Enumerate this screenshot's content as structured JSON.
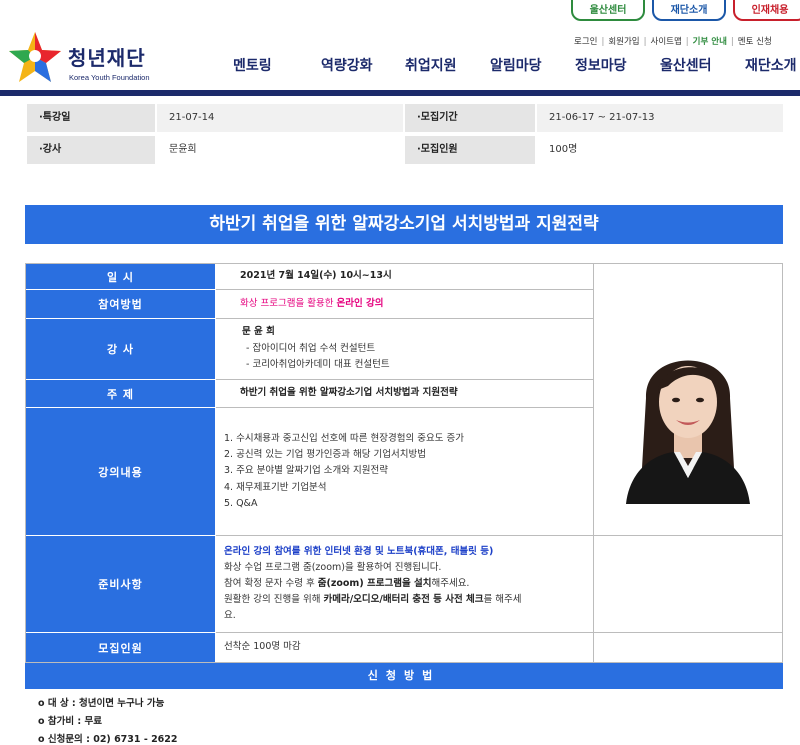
{
  "header": {
    "top_buttons": {
      "ulsan": "울산센터",
      "about": "재단소개",
      "hire": "인재채용"
    },
    "util_links": [
      "로그인",
      "회원가입",
      "사이트맵",
      "기부 안내",
      "멘토 신청"
    ],
    "logo": {
      "kr": "청년재단",
      "en": "Korea Youth Foundation"
    },
    "nav": [
      "멘토링",
      "역량강화",
      "취업지원",
      "알림마당",
      "정보마당",
      "울산센터",
      "재단소개"
    ]
  },
  "info": {
    "special_date_label": "·특강일",
    "special_date": "21-07-14",
    "period_label": "·모집기간",
    "period": "21-06-17 ~ 21-07-13",
    "lecturer_label": "·강사",
    "lecturer": "문윤희",
    "capacity_label": "·모집인원",
    "capacity": "100명"
  },
  "title": "하반기 취업을 위한 알짜강소기업 서치방법과 지원전략",
  "detail": {
    "datetime_label": "일 시",
    "datetime": "2021년 7월 14일(수) 10시~13시",
    "method_label": "참여방법",
    "method_prefix": "화상 프로그램을 활용한 ",
    "method_bold": "온라인 강의",
    "lecturer_label": "강 사",
    "lecturer_name": "문 윤 희",
    "lecturer_career": [
      "- 잡아이디어 취업 수석 컨설턴트",
      "- 코리아취업아카데미 대표 컨설턴트"
    ],
    "topic_label": "주 제",
    "topic": "하반기 취업을 위한 알짜강소기업 서치방법과 지원전략",
    "content_label": "강의내용",
    "content": [
      "1. 수시채용과 중고신입 선호에 따른 현장경험의 중요도 증가",
      "2. 공신력 있는 기업 평가인증과 해당 기업서치방법",
      "3. 주요 분야별 알짜기업 소개와 지원전략",
      "4. 재무제표기반 기업분석",
      "5. Q&A"
    ],
    "prep_label": "준비사항",
    "prep_line1": "온라인 강의 참여를 위한 인터넷 환경 및 노트북(휴대폰, 태블릿 등)",
    "prep_line2": "화상 수업 프로그램 줌(zoom)을 활용하여 진행됩니다.",
    "prep_line3_a": "참여 확정 문자 수령 후 ",
    "prep_line3_b": "줌(zoom) 프로그램을 설치",
    "prep_line3_c": "해주세요.",
    "prep_line4_a": "원활한 강의 진행을 위해 ",
    "prep_line4_b": "카메라/오디오/배터리 충전 등 사전 체크",
    "prep_line4_c": "를 해주세",
    "prep_line5": "요.",
    "capacity_label": "모집인원",
    "capacity": "선착순 100명 마감"
  },
  "apply": {
    "bar_label": "신청방법",
    "lines": [
      "o 대 상 : 청년이면 누구나 가능",
      "o 참가비 : 무료",
      "o 신청문의 : 02) 6731 - 2622"
    ]
  },
  "colors": {
    "navy": "#1c2a6b",
    "blue": "#2a6fe0",
    "pink": "#e5007e",
    "green": "#2e8b3e",
    "red": "#c8202c"
  }
}
